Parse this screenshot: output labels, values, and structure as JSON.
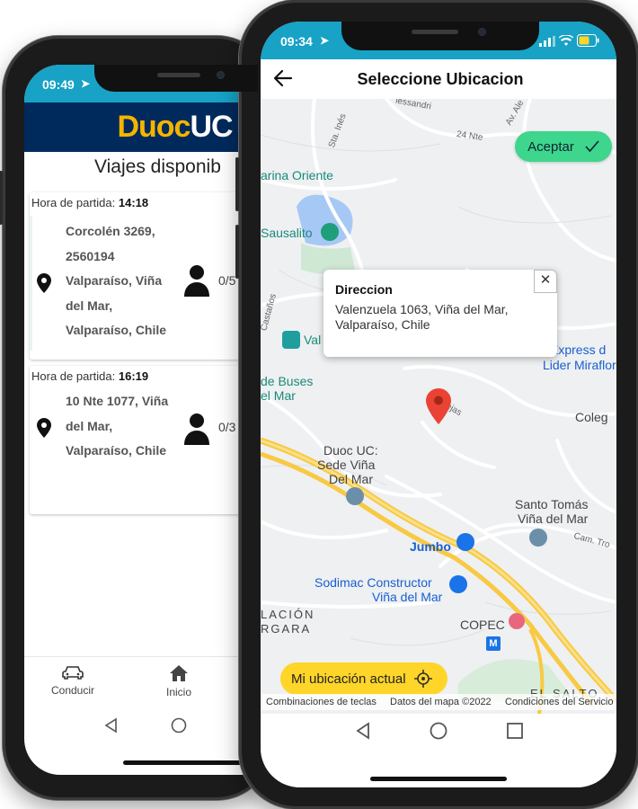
{
  "back_phone": {
    "status_time": "09:49",
    "logo_part1": "Duoc",
    "logo_part2": "UC",
    "title": "Viajes disponib",
    "trips": [
      {
        "hora_label": "Hora de partida:",
        "hora": "14:18",
        "addr": [
          "Corcolén 3269,",
          "2560194",
          "Valparaíso, Viña",
          "del Mar,",
          "Valparaíso, Chile"
        ],
        "seats": "0/5"
      },
      {
        "hora_label": "Hora de partida:",
        "hora": "16:19",
        "addr": [
          "10 Nte 1077, Viña",
          "del Mar,",
          "Valparaíso, Chile"
        ],
        "seats": "0/3"
      }
    ],
    "nav": [
      {
        "label": "Conducir",
        "icon": "car-icon"
      },
      {
        "label": "Inicio",
        "icon": "home-icon"
      }
    ]
  },
  "front_phone": {
    "status_time": "09:34",
    "title": "Seleccione Ubicacion",
    "aceptar": "Aceptar",
    "info_window": {
      "title": "Direccion",
      "text": "Valenzuela 1063, Viña del Mar, Valparaíso, Chile"
    },
    "mi_ubicacion": "Mi ubicación actual",
    "map_labels": {
      "marina": "arina Oriente",
      "sausalito": "Sausalito",
      "val": "Val",
      "buses": "de Buses",
      "mar": "el Mar",
      "express": "Express d",
      "lider": "Lider Miraflore",
      "colegio": "Coleg",
      "duoc1": "Duoc UC:",
      "duoc2": "Sede Viña",
      "duoc3": "Del Mar",
      "santo1": "Santo Tomás",
      "santo2": "Viña del Mar",
      "jumbo": "Jumbo",
      "sodimac1": "Sodimac Constructor",
      "sodimac2": "Viña del Mar",
      "copec": "COPEC",
      "lacion": "LACIÓN",
      "rgara": "RGARA",
      "el_salto": "EL SALTO",
      "la_rejas": "La Rejas",
      "nte24": "24 Nte",
      "alessandri": "lessandri",
      "sta_ines": "Sta. Inés",
      "castanos": "Castaños",
      "av": "Av. Ale",
      "cam": "Cam. Tro"
    },
    "attribution": {
      "teclas": "Combinaciones de teclas",
      "datos": "Datos del mapa ©2022",
      "condiciones": "Condiciones del Servicio"
    }
  },
  "colors": {
    "status_bar": "#17a2c6",
    "duoc_navy": "#002a5c",
    "duoc_yellow": "#f5b400",
    "accept_green": "#3dd68c",
    "location_yellow": "#ffd52a",
    "marker_red": "#ea4335"
  }
}
